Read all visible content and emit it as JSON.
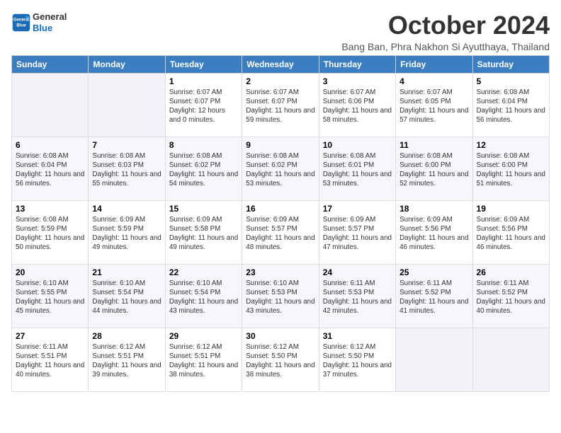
{
  "logo": {
    "line1": "General",
    "line2": "Blue"
  },
  "title": "October 2024",
  "subtitle": "Bang Ban, Phra Nakhon Si Ayutthaya, Thailand",
  "weekdays": [
    "Sunday",
    "Monday",
    "Tuesday",
    "Wednesday",
    "Thursday",
    "Friday",
    "Saturday"
  ],
  "weeks": [
    [
      {
        "day": "",
        "sunrise": "",
        "sunset": "",
        "daylight": ""
      },
      {
        "day": "",
        "sunrise": "",
        "sunset": "",
        "daylight": ""
      },
      {
        "day": "1",
        "sunrise": "Sunrise: 6:07 AM",
        "sunset": "Sunset: 6:07 PM",
        "daylight": "Daylight: 12 hours and 0 minutes."
      },
      {
        "day": "2",
        "sunrise": "Sunrise: 6:07 AM",
        "sunset": "Sunset: 6:07 PM",
        "daylight": "Daylight: 11 hours and 59 minutes."
      },
      {
        "day": "3",
        "sunrise": "Sunrise: 6:07 AM",
        "sunset": "Sunset: 6:06 PM",
        "daylight": "Daylight: 11 hours and 58 minutes."
      },
      {
        "day": "4",
        "sunrise": "Sunrise: 6:07 AM",
        "sunset": "Sunset: 6:05 PM",
        "daylight": "Daylight: 11 hours and 57 minutes."
      },
      {
        "day": "5",
        "sunrise": "Sunrise: 6:08 AM",
        "sunset": "Sunset: 6:04 PM",
        "daylight": "Daylight: 11 hours and 56 minutes."
      }
    ],
    [
      {
        "day": "6",
        "sunrise": "Sunrise: 6:08 AM",
        "sunset": "Sunset: 6:04 PM",
        "daylight": "Daylight: 11 hours and 56 minutes."
      },
      {
        "day": "7",
        "sunrise": "Sunrise: 6:08 AM",
        "sunset": "Sunset: 6:03 PM",
        "daylight": "Daylight: 11 hours and 55 minutes."
      },
      {
        "day": "8",
        "sunrise": "Sunrise: 6:08 AM",
        "sunset": "Sunset: 6:02 PM",
        "daylight": "Daylight: 11 hours and 54 minutes."
      },
      {
        "day": "9",
        "sunrise": "Sunrise: 6:08 AM",
        "sunset": "Sunset: 6:02 PM",
        "daylight": "Daylight: 11 hours and 53 minutes."
      },
      {
        "day": "10",
        "sunrise": "Sunrise: 6:08 AM",
        "sunset": "Sunset: 6:01 PM",
        "daylight": "Daylight: 11 hours and 53 minutes."
      },
      {
        "day": "11",
        "sunrise": "Sunrise: 6:08 AM",
        "sunset": "Sunset: 6:00 PM",
        "daylight": "Daylight: 11 hours and 52 minutes."
      },
      {
        "day": "12",
        "sunrise": "Sunrise: 6:08 AM",
        "sunset": "Sunset: 6:00 PM",
        "daylight": "Daylight: 11 hours and 51 minutes."
      }
    ],
    [
      {
        "day": "13",
        "sunrise": "Sunrise: 6:08 AM",
        "sunset": "Sunset: 5:59 PM",
        "daylight": "Daylight: 11 hours and 50 minutes."
      },
      {
        "day": "14",
        "sunrise": "Sunrise: 6:09 AM",
        "sunset": "Sunset: 5:59 PM",
        "daylight": "Daylight: 11 hours and 49 minutes."
      },
      {
        "day": "15",
        "sunrise": "Sunrise: 6:09 AM",
        "sunset": "Sunset: 5:58 PM",
        "daylight": "Daylight: 11 hours and 49 minutes."
      },
      {
        "day": "16",
        "sunrise": "Sunrise: 6:09 AM",
        "sunset": "Sunset: 5:57 PM",
        "daylight": "Daylight: 11 hours and 48 minutes."
      },
      {
        "day": "17",
        "sunrise": "Sunrise: 6:09 AM",
        "sunset": "Sunset: 5:57 PM",
        "daylight": "Daylight: 11 hours and 47 minutes."
      },
      {
        "day": "18",
        "sunrise": "Sunrise: 6:09 AM",
        "sunset": "Sunset: 5:56 PM",
        "daylight": "Daylight: 11 hours and 46 minutes."
      },
      {
        "day": "19",
        "sunrise": "Sunrise: 6:09 AM",
        "sunset": "Sunset: 5:56 PM",
        "daylight": "Daylight: 11 hours and 46 minutes."
      }
    ],
    [
      {
        "day": "20",
        "sunrise": "Sunrise: 6:10 AM",
        "sunset": "Sunset: 5:55 PM",
        "daylight": "Daylight: 11 hours and 45 minutes."
      },
      {
        "day": "21",
        "sunrise": "Sunrise: 6:10 AM",
        "sunset": "Sunset: 5:54 PM",
        "daylight": "Daylight: 11 hours and 44 minutes."
      },
      {
        "day": "22",
        "sunrise": "Sunrise: 6:10 AM",
        "sunset": "Sunset: 5:54 PM",
        "daylight": "Daylight: 11 hours and 43 minutes."
      },
      {
        "day": "23",
        "sunrise": "Sunrise: 6:10 AM",
        "sunset": "Sunset: 5:53 PM",
        "daylight": "Daylight: 11 hours and 43 minutes."
      },
      {
        "day": "24",
        "sunrise": "Sunrise: 6:11 AM",
        "sunset": "Sunset: 5:53 PM",
        "daylight": "Daylight: 11 hours and 42 minutes."
      },
      {
        "day": "25",
        "sunrise": "Sunrise: 6:11 AM",
        "sunset": "Sunset: 5:52 PM",
        "daylight": "Daylight: 11 hours and 41 minutes."
      },
      {
        "day": "26",
        "sunrise": "Sunrise: 6:11 AM",
        "sunset": "Sunset: 5:52 PM",
        "daylight": "Daylight: 11 hours and 40 minutes."
      }
    ],
    [
      {
        "day": "27",
        "sunrise": "Sunrise: 6:11 AM",
        "sunset": "Sunset: 5:51 PM",
        "daylight": "Daylight: 11 hours and 40 minutes."
      },
      {
        "day": "28",
        "sunrise": "Sunrise: 6:12 AM",
        "sunset": "Sunset: 5:51 PM",
        "daylight": "Daylight: 11 hours and 39 minutes."
      },
      {
        "day": "29",
        "sunrise": "Sunrise: 6:12 AM",
        "sunset": "Sunset: 5:51 PM",
        "daylight": "Daylight: 11 hours and 38 minutes."
      },
      {
        "day": "30",
        "sunrise": "Sunrise: 6:12 AM",
        "sunset": "Sunset: 5:50 PM",
        "daylight": "Daylight: 11 hours and 38 minutes."
      },
      {
        "day": "31",
        "sunrise": "Sunrise: 6:12 AM",
        "sunset": "Sunset: 5:50 PM",
        "daylight": "Daylight: 11 hours and 37 minutes."
      },
      {
        "day": "",
        "sunrise": "",
        "sunset": "",
        "daylight": ""
      },
      {
        "day": "",
        "sunrise": "",
        "sunset": "",
        "daylight": ""
      }
    ]
  ]
}
